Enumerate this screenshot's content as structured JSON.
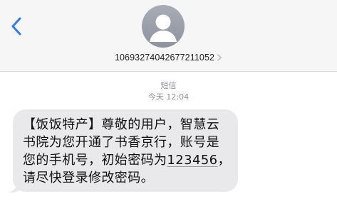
{
  "header": {
    "back_icon": "chevron-left-icon",
    "avatar_icon": "person-avatar-icon",
    "sender_number": "10693274042677211052",
    "chevron_icon": "chevron-right-icon",
    "accent_color": "#3478f6"
  },
  "conversation": {
    "channel_label": "短信",
    "timestamp": "今天 12:04",
    "message": {
      "text_before": "【饭饭特产】尊敬的用户，智慧云书院为您开通了书香京行，账号是您的手机号，初始密码为",
      "code": "123456",
      "text_after": "，请尽快登录修改密码。"
    }
  }
}
